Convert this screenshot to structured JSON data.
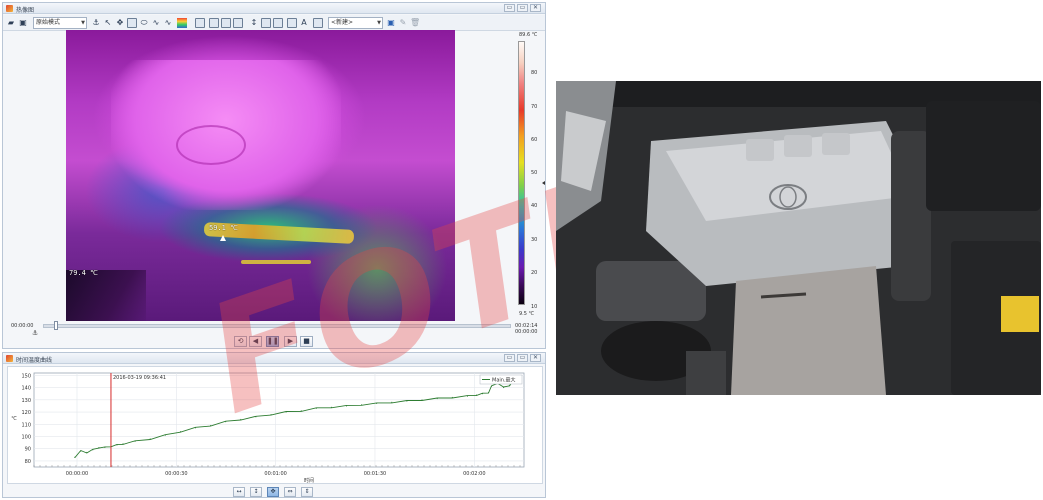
{
  "thermal_window": {
    "title": "热像图",
    "mode_select": "原始模式",
    "object_select": "<新建>",
    "window_buttons": [
      "▭",
      "▭",
      "✕"
    ],
    "hot_spot_label": "59.1 ℃",
    "cold_spot_label": "79.4 ℃",
    "palette_max": "89.6 ℃",
    "palette_min": "9.5 ℃",
    "palette_ticks": [
      "80",
      "70",
      "60",
      "50",
      "40",
      "30",
      "20",
      "10"
    ],
    "time_start": "00:00:00",
    "time_elapsed": "00:02:14",
    "time_total": "00:00:00"
  },
  "curve_window": {
    "title": "时间温度曲线",
    "window_buttons": [
      "▭",
      "▭",
      "✕"
    ],
    "cursor_label": "2016-03-19 09:36:41",
    "legend_label": "Main.最大",
    "xlabel": "时间",
    "ylabel": "℃"
  },
  "chart_data": {
    "type": "line",
    "title": "",
    "xlabel": "时间",
    "ylabel": "℃",
    "x_ticks": [
      "00:00:00",
      "00:00:30",
      "00:01:00",
      "00:01:30",
      "00:02:00"
    ],
    "y_ticks": [
      150,
      140,
      130,
      120,
      110,
      100,
      90,
      80
    ],
    "xlim": [
      0,
      148
    ],
    "ylim": [
      75,
      152
    ],
    "grid": true,
    "legend_position": "top-right",
    "series": [
      {
        "name": "Main.最大",
        "color": "#2e7d32",
        "x": [
          0,
          2,
          4,
          6,
          8,
          10,
          12,
          14,
          16,
          20,
          25,
          30,
          35,
          40,
          45,
          50,
          55,
          60,
          65,
          70,
          75,
          80,
          85,
          90,
          95,
          100,
          105,
          110,
          115,
          120,
          125,
          130,
          133,
          135,
          137,
          138,
          140,
          142,
          144,
          145
        ],
        "y": [
          83,
          88,
          87,
          89,
          91,
          91,
          92,
          93,
          94,
          96,
          98,
          101,
          104,
          107,
          109,
          112,
          114,
          116,
          118,
          120,
          121,
          123,
          124,
          125,
          126,
          127,
          128,
          129,
          130,
          131,
          132,
          133,
          134,
          135,
          136,
          141,
          144,
          140,
          142,
          145
        ]
      }
    ],
    "cursor_x": 12
  },
  "colors": {
    "accent": "#3a78c8",
    "cursor_line": "#d62a2a",
    "watermark": "#e44646"
  },
  "watermark_text": "FOTRIC"
}
